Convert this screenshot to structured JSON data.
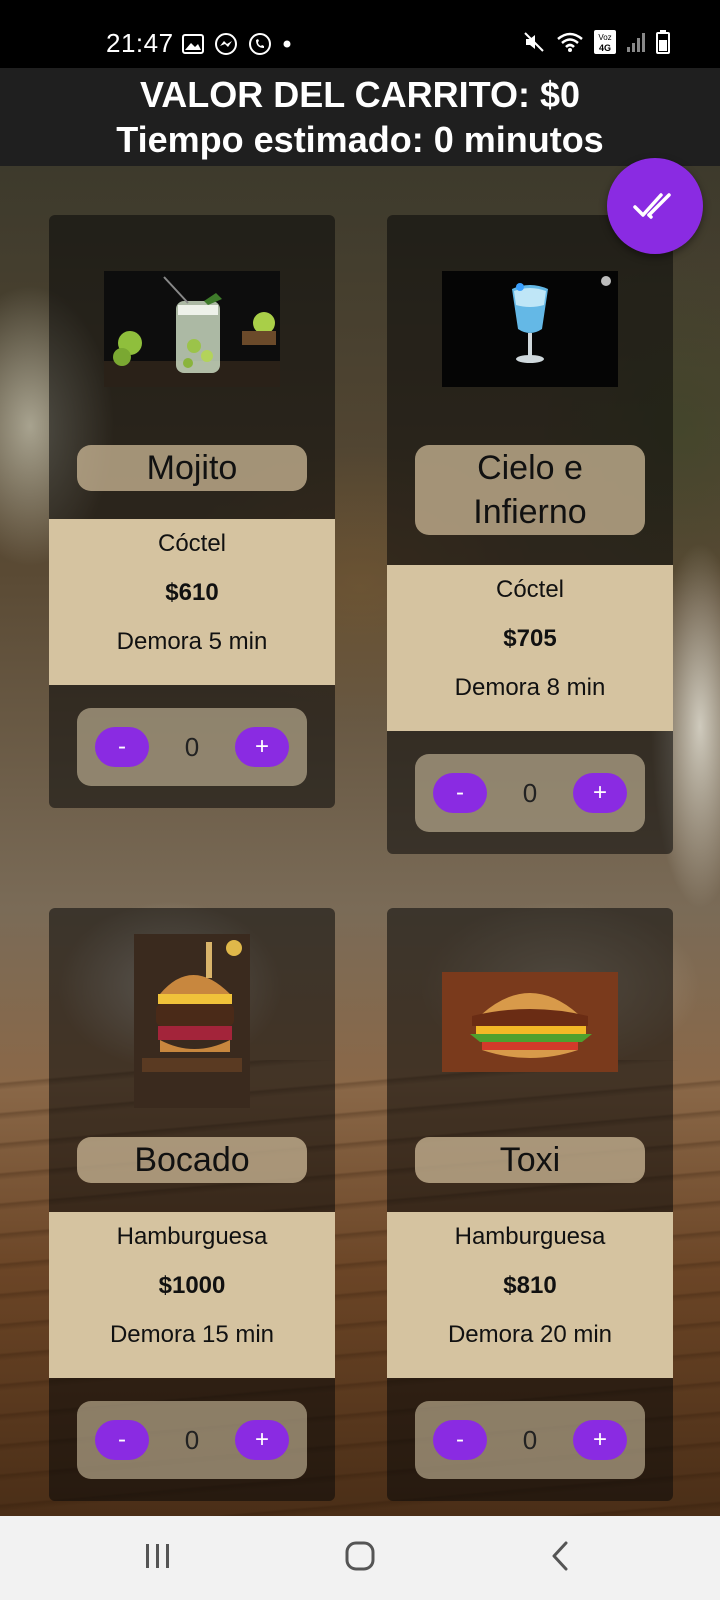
{
  "status_bar": {
    "time": "21:47",
    "left_icons": [
      "gallery-icon",
      "messenger-icon",
      "whatsapp-icon",
      "dot-icon"
    ],
    "right_icons": [
      "mute-icon",
      "wifi-icon",
      "volte-icon",
      "signal-icon",
      "battery-icon"
    ],
    "volte_label_top": "Voz",
    "volte_label_bottom": "4G"
  },
  "header": {
    "cart_value": "VALOR DEL CARRITO: $0",
    "estimated_time": "Tiempo estimado: 0 minutos"
  },
  "fab": {
    "icon": "double-check-icon"
  },
  "products": [
    {
      "name": "Mojito",
      "category": "Cóctel",
      "price": "$610",
      "delay": "Demora 5 min",
      "quantity": "0",
      "minus_label": "-",
      "plus_label": "+"
    },
    {
      "name": "Cielo e Infierno",
      "category": "Cóctel",
      "price": "$705",
      "delay": "Demora 8 min",
      "quantity": "0",
      "minus_label": "-",
      "plus_label": "+"
    },
    {
      "name": "Bocado",
      "category": "Hamburguesa",
      "price": "$1000",
      "delay": "Demora 15 min",
      "quantity": "0",
      "minus_label": "-",
      "plus_label": "+"
    },
    {
      "name": "Toxi",
      "category": "Hamburguesa",
      "price": "$810",
      "delay": "Demora 20 min",
      "quantity": "0",
      "minus_label": "-",
      "plus_label": "+"
    }
  ],
  "nav_bar": {
    "icons": [
      "recent-apps-icon",
      "home-icon",
      "back-icon"
    ]
  },
  "colors": {
    "accent": "#8a2be2",
    "info_bg": "#d5c3a0",
    "header_bg": "#1f1f1f"
  }
}
